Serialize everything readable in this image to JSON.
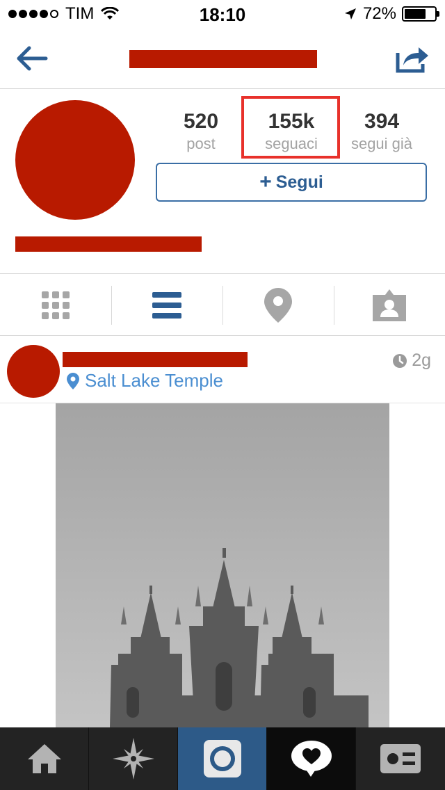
{
  "status_bar": {
    "carrier": "TIM",
    "time": "18:10",
    "battery_percent": "72%",
    "battery_level": 0.72,
    "signal_bars_filled": 4,
    "signal_bars_total": 5
  },
  "nav": {
    "back_icon": "back-arrow-icon",
    "share_icon": "share-icon"
  },
  "profile": {
    "stats": {
      "posts_count": "520",
      "posts_label": "post",
      "followers_count": "155k",
      "followers_label": "seguaci",
      "following_count": "394",
      "following_label": "segui già"
    },
    "follow_button_plus": "+",
    "follow_button_label": "Segui"
  },
  "view_tabs": [
    "grid-view-icon",
    "list-view-icon",
    "map-pin-icon",
    "tagged-photos-icon"
  ],
  "post": {
    "location": "Salt Lake Temple",
    "time_ago": "2g"
  },
  "tab_bar": {
    "items": [
      "home-icon",
      "explore-icon",
      "camera-icon",
      "news-icon",
      "profile-icon"
    ],
    "active": "camera-icon"
  },
  "colors": {
    "redaction": "#b81a00",
    "accent_blue": "#2c5d92",
    "link_blue": "#4a8ed1",
    "highlight_red": "#e8312b",
    "tabbar_bg": "#232323",
    "tabbar_active": "#2d5a88"
  }
}
